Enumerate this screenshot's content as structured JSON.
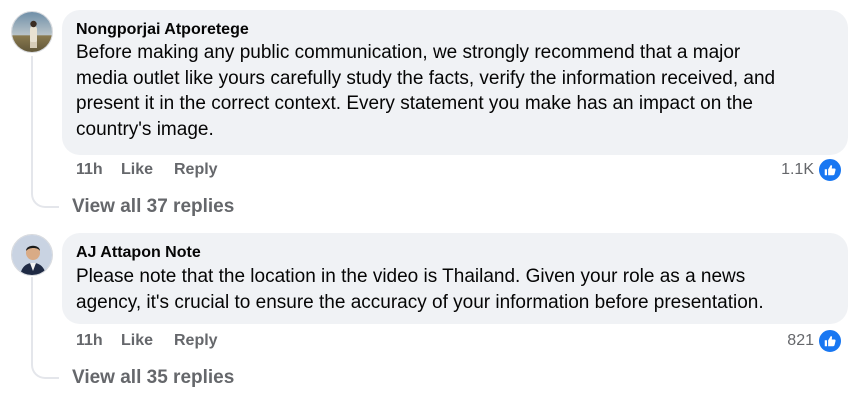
{
  "comments": [
    {
      "author": "Nongporjai Atporetege",
      "lines": [
        "Before making any public communication, we strongly recommend that a major",
        "media outlet like yours carefully study the facts, verify the information received, and",
        "present it in the correct context. Every statement you make has an impact on the",
        "country's image."
      ],
      "time": "11h",
      "like_label": "Like",
      "reply_label": "Reply",
      "reaction_count": "1.1K",
      "reaction_icon": "like-thumb-icon",
      "view_replies": "View all 37 replies"
    },
    {
      "author": "AJ Attapon Note",
      "lines": [
        "Please note that the location in the video is Thailand. Given your role as a news",
        "agency, it's crucial to ensure the accuracy of your information before presentation."
      ],
      "time": "11h",
      "like_label": "Like",
      "reply_label": "Reply",
      "reaction_count": "821",
      "reaction_icon": "like-thumb-icon",
      "view_replies": "View all 35 replies"
    }
  ],
  "colors": {
    "bubble": "#f0f2f5",
    "meta_text": "#65676b",
    "like_blue": "#1877f2",
    "thread_line": "#e4e6eb"
  }
}
